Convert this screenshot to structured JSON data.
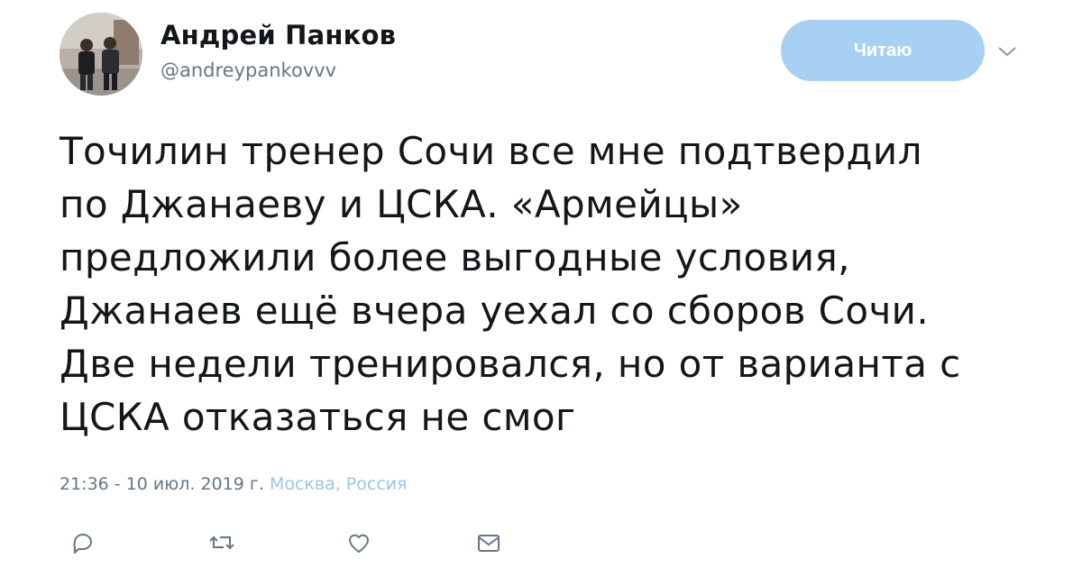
{
  "author": {
    "name": "Андрей Панков",
    "handle": "@andreypankovvv"
  },
  "follow_button": {
    "label": "Читаю"
  },
  "tweet": {
    "lines": [
      "Точилин тренер Сочи все мне подтвердил",
      "по Джанаеву и ЦСКА. «Армейцы»",
      "предложили более выгодные условия,",
      "Джанаев ещё вчера уехал со сборов Сочи.",
      "Две недели тренировался, но от варианта с",
      "ЦСКА отказаться не смог"
    ]
  },
  "meta": {
    "time": "21:36 - 10 июл. 2019 г.",
    "location": "Москва, Россия"
  },
  "colors": {
    "follow_button_bg": "#a7d0f2",
    "link": "#9cc6ea",
    "secondary_text": "#657786",
    "icon": "#657786"
  },
  "icons": {
    "caret": "chevron-down-icon",
    "reply": "reply-icon",
    "retweet": "retweet-icon",
    "like": "heart-icon",
    "message": "envelope-icon"
  }
}
